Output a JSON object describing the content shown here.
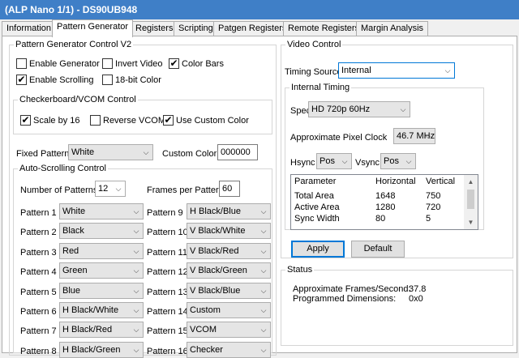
{
  "window": {
    "title": "(ALP Nano 1/1) - DS90UB948"
  },
  "tabs": [
    {
      "label": "Information"
    },
    {
      "label": "Pattern Generator"
    },
    {
      "label": "Registers"
    },
    {
      "label": "Scripting"
    },
    {
      "label": "Patgen Registers"
    },
    {
      "label": "Remote Registers"
    },
    {
      "label": "Margin Analysis"
    }
  ],
  "pgc": {
    "title": "Pattern Generator Control V2",
    "enable_generator": "Enable Generator",
    "invert_video": "Invert Video",
    "color_bars": "Color Bars",
    "enable_scrolling": "Enable Scrolling",
    "bit18_color": "18-bit Color",
    "states": {
      "enable_generator": false,
      "invert_video": false,
      "color_bars": true,
      "enable_scrolling": true,
      "bit18_color": false
    }
  },
  "checker": {
    "title": "Checkerboard/VCOM Control",
    "scale_by_16": "Scale by 16",
    "reverse_vcom": "Reverse VCOM",
    "use_custom_color": "Use Custom Color",
    "states": {
      "scale_by_16": true,
      "reverse_vcom": false,
      "use_custom_color": true
    }
  },
  "fixed": {
    "label": "Fixed Pattern",
    "value": "White",
    "custom_color_label": "Custom Color #",
    "custom_color_value": "000000"
  },
  "auto": {
    "title": "Auto-Scrolling Control",
    "num_label": "Number of Patterns",
    "num_value": "12",
    "fpp_label": "Frames per Pattern",
    "fpp_value": "60",
    "patterns": [
      {
        "label": "Pattern  1",
        "value": "White"
      },
      {
        "label": "Pattern  2",
        "value": "Black"
      },
      {
        "label": "Pattern  3",
        "value": "Red"
      },
      {
        "label": "Pattern  4",
        "value": "Green"
      },
      {
        "label": "Pattern  5",
        "value": "Blue"
      },
      {
        "label": "Pattern  6",
        "value": "H Black/White"
      },
      {
        "label": "Pattern  7",
        "value": "H Black/Red"
      },
      {
        "label": "Pattern  8",
        "value": "H Black/Green"
      },
      {
        "label": "Pattern  9",
        "value": "H Black/Blue"
      },
      {
        "label": "Pattern 10",
        "value": "V Black/White"
      },
      {
        "label": "Pattern 11",
        "value": "V Black/Red"
      },
      {
        "label": "Pattern 12",
        "value": "V Black/Green"
      },
      {
        "label": "Pattern 13",
        "value": "V Black/Blue"
      },
      {
        "label": "Pattern 14",
        "value": "Custom"
      },
      {
        "label": "Pattern 15",
        "value": "VCOM"
      },
      {
        "label": "Pattern 16",
        "value": "Checker"
      }
    ]
  },
  "video": {
    "title": "Video Control",
    "timing_source_label": "Timing Source",
    "timing_source_value": "Internal",
    "internal_title": "Internal Timing",
    "spec_label": "Spec",
    "spec_value": "HD 720p 60Hz",
    "pixel_clock_label": "Approximate Pixel Clock",
    "pixel_clock_value": "46.7 MHz",
    "hsync_label": "Hsync",
    "hsync_value": "Pos",
    "vsync_label": "Vsync",
    "vsync_value": "Pos",
    "table": {
      "headers": [
        "Parameter",
        "Horizontal",
        "Vertical"
      ],
      "rows": [
        [
          "Total Area",
          "1648",
          "750"
        ],
        [
          "Active Area",
          "1280",
          "720"
        ],
        [
          "Sync Width",
          "80",
          "5"
        ]
      ]
    },
    "apply_label": "Apply",
    "default_label": "Default"
  },
  "status": {
    "title": "Status",
    "frames_label": "Approximate Frames/Second:",
    "frames_value": "37.8",
    "dims_label": "Programmed Dimensions:",
    "dims_value": "0x0"
  },
  "icons": {
    "check": "checkmark-icon",
    "dropdown": "chevron-down-icon"
  },
  "colors": {
    "titlebar": "#3f7fc7",
    "focus": "#0078d7"
  }
}
